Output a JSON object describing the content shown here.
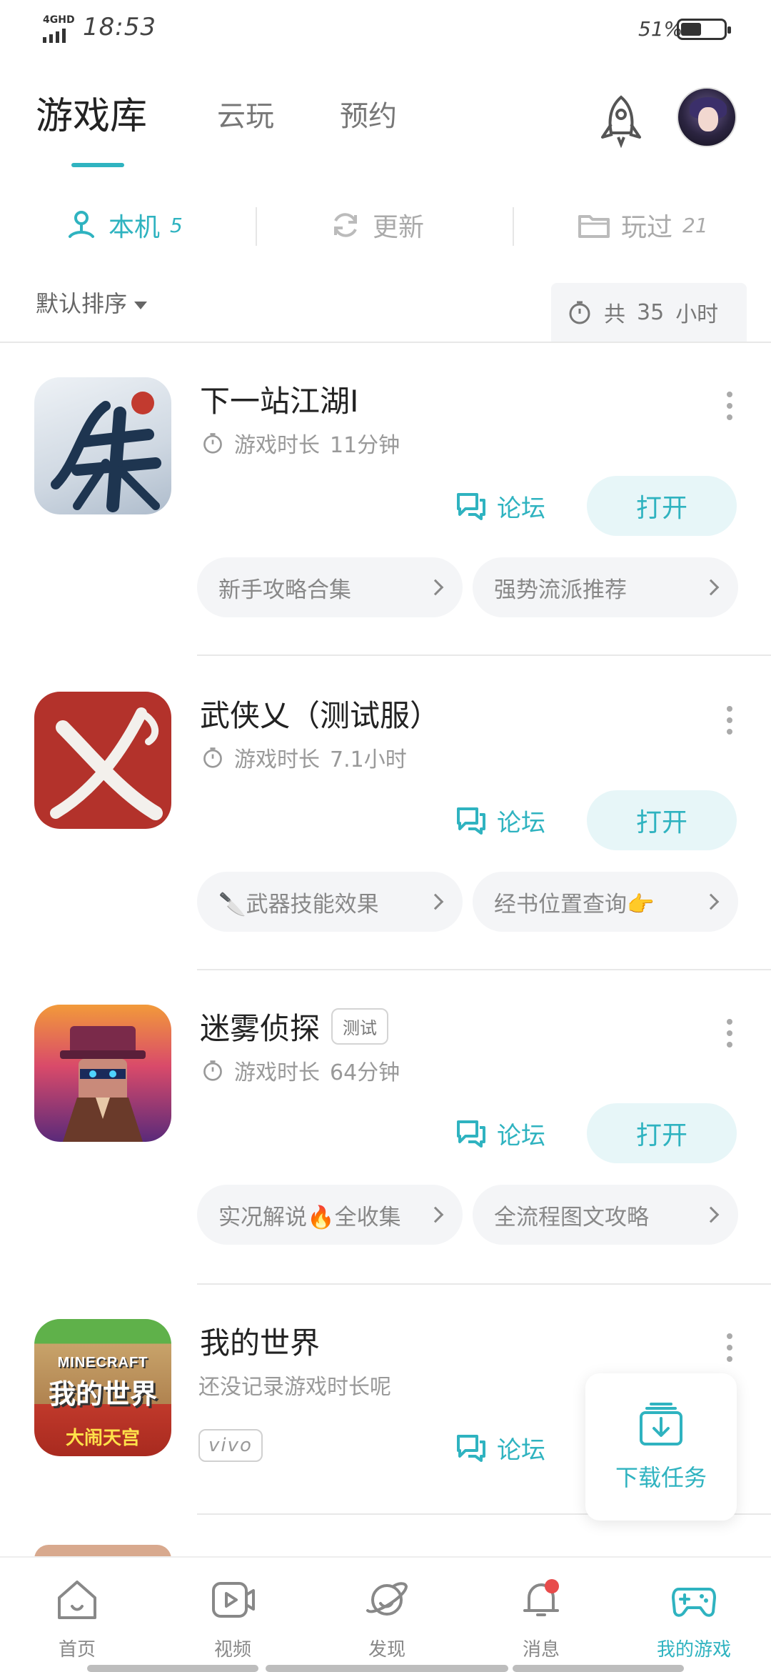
{
  "status_bar": {
    "network": "4GHD",
    "time": "18:53",
    "battery": "51%"
  },
  "top_tabs": [
    {
      "label": "游戏库",
      "active": true
    },
    {
      "label": "云玩",
      "active": false
    },
    {
      "label": "预约",
      "active": false
    }
  ],
  "sub_tabs": [
    {
      "label": "本机",
      "count": "5",
      "active": true,
      "icon": "device-icon"
    },
    {
      "label": "更新",
      "count": "",
      "active": false,
      "icon": "refresh-icon"
    },
    {
      "label": "玩过",
      "count": "21",
      "active": false,
      "icon": "folder-icon"
    }
  ],
  "sort": {
    "label": "默认排序"
  },
  "total_time": {
    "prefix": "共",
    "value": "35",
    "unit": "小时"
  },
  "games": [
    {
      "name": "下一站江湖Ⅰ",
      "tag": "",
      "playtime_label": "游戏时长",
      "playtime_value": "11分钟",
      "forum_label": "论坛",
      "open_label": "打开",
      "chips": [
        "新手攻略合集",
        "强势流派推荐"
      ]
    },
    {
      "name": "武侠乂（测试服）",
      "tag": "",
      "playtime_label": "游戏时长",
      "playtime_value": "7.1小时",
      "forum_label": "论坛",
      "open_label": "打开",
      "chips": [
        "🔪武器技能效果",
        "经书位置查询👉"
      ]
    },
    {
      "name": "迷雾侦探",
      "tag": "测试",
      "playtime_label": "游戏时长",
      "playtime_value": "64分钟",
      "forum_label": "论坛",
      "open_label": "打开",
      "chips": [
        "实况解说🔥全收集",
        "全流程图文攻略"
      ]
    },
    {
      "name": "我的世界",
      "no_record": "还没记录游戏时长呢",
      "badge": "vivo",
      "forum_label": "论坛",
      "icon_text_top": "MINECRAFT",
      "icon_text_mid": "我的世界",
      "icon_text_bottom": "大闹天宫"
    }
  ],
  "download_task": {
    "label": "下载任务"
  },
  "bottom_nav": [
    {
      "label": "首页",
      "icon": "home-icon",
      "active": false
    },
    {
      "label": "视频",
      "icon": "video-icon",
      "active": false
    },
    {
      "label": "发现",
      "icon": "planet-icon",
      "active": false
    },
    {
      "label": "消息",
      "icon": "bell-icon",
      "active": false
    },
    {
      "label": "我的游戏",
      "icon": "gamepad-icon",
      "active": true
    }
  ],
  "colors": {
    "accent": "#2fb3c0",
    "chip_bg": "#f4f5f7",
    "badge_red": "#e84b4b"
  }
}
